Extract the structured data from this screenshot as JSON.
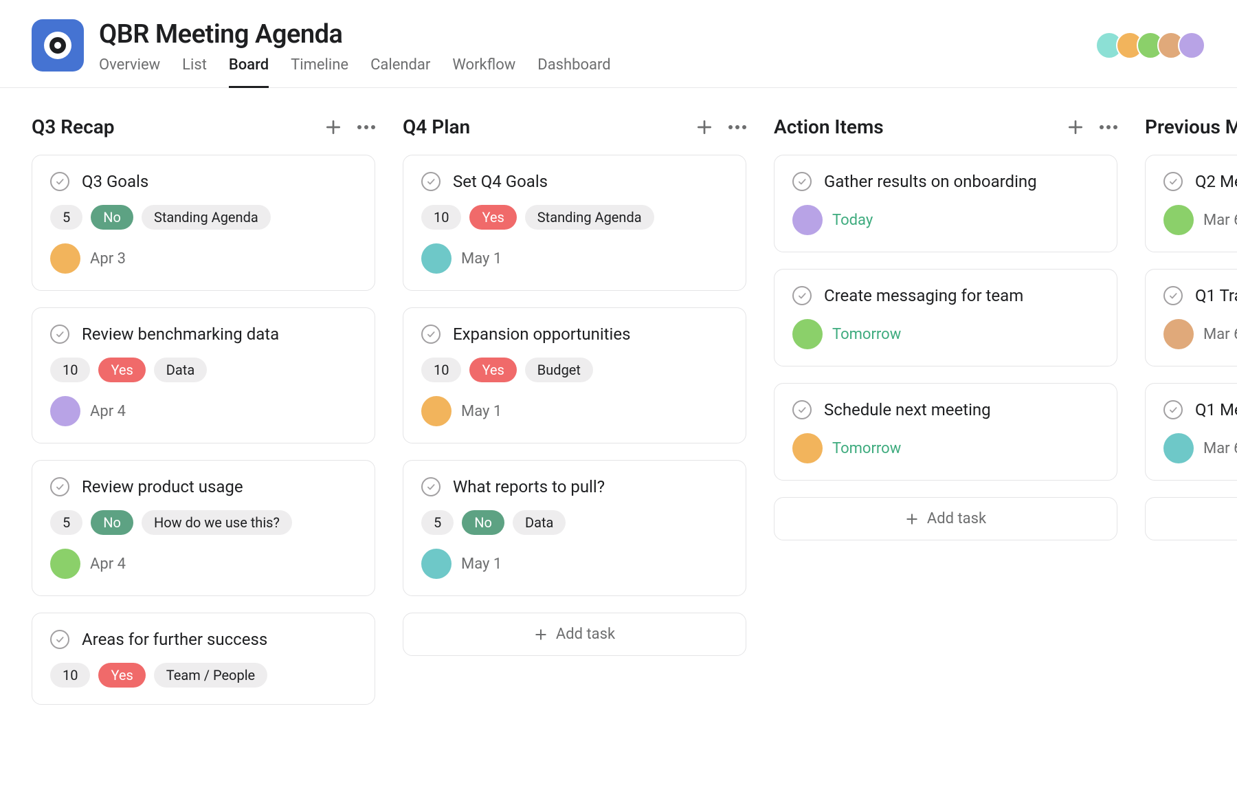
{
  "header": {
    "title": "QBR Meeting Agenda",
    "tabs": [
      {
        "label": "Overview",
        "active": false
      },
      {
        "label": "List",
        "active": false
      },
      {
        "label": "Board",
        "active": true
      },
      {
        "label": "Timeline",
        "active": false
      },
      {
        "label": "Calendar",
        "active": false
      },
      {
        "label": "Workflow",
        "active": false
      },
      {
        "label": "Dashboard",
        "active": false
      }
    ],
    "members": [
      {
        "color": "#8ce0d5"
      },
      {
        "color": "#f2b45c"
      },
      {
        "color": "#8bd06a"
      },
      {
        "color": "#e0a97a"
      },
      {
        "color": "#b8a3e6"
      }
    ]
  },
  "avatarColors": {
    "orange": "#f2b45c",
    "purple": "#b8a3e6",
    "green": "#8bd06a",
    "teal": "#6ec8c8",
    "tan": "#e0a97a"
  },
  "ui": {
    "add_task_label": "Add task"
  },
  "columns": [
    {
      "title": "Q3 Recap",
      "show_add_task": false,
      "cards": [
        {
          "title": "Q3 Goals",
          "pills": [
            {
              "text": "5",
              "variant": ""
            },
            {
              "text": "No",
              "variant": "green"
            },
            {
              "text": "Standing Agenda",
              "variant": ""
            }
          ],
          "assignee": "orange",
          "date": "Apr 3",
          "date_highlight": false,
          "show_footer": true
        },
        {
          "title": "Review benchmarking data",
          "pills": [
            {
              "text": "10",
              "variant": ""
            },
            {
              "text": "Yes",
              "variant": "red"
            },
            {
              "text": "Data",
              "variant": ""
            }
          ],
          "assignee": "purple",
          "date": "Apr 4",
          "date_highlight": false,
          "show_footer": true
        },
        {
          "title": "Review product usage",
          "pills": [
            {
              "text": "5",
              "variant": ""
            },
            {
              "text": "No",
              "variant": "green"
            },
            {
              "text": "How do we use this?",
              "variant": ""
            }
          ],
          "assignee": "green",
          "date": "Apr 4",
          "date_highlight": false,
          "show_footer": true
        },
        {
          "title": "Areas for further success",
          "pills": [
            {
              "text": "10",
              "variant": ""
            },
            {
              "text": "Yes",
              "variant": "red"
            },
            {
              "text": "Team / People",
              "variant": ""
            }
          ],
          "assignee": "",
          "date": "",
          "date_highlight": false,
          "show_footer": false
        }
      ]
    },
    {
      "title": "Q4 Plan",
      "show_add_task": true,
      "cards": [
        {
          "title": "Set Q4 Goals",
          "pills": [
            {
              "text": "10",
              "variant": ""
            },
            {
              "text": "Yes",
              "variant": "red"
            },
            {
              "text": "Standing Agenda",
              "variant": ""
            }
          ],
          "assignee": "teal",
          "date": "May 1",
          "date_highlight": false,
          "show_footer": true
        },
        {
          "title": "Expansion opportunities",
          "pills": [
            {
              "text": "10",
              "variant": ""
            },
            {
              "text": "Yes",
              "variant": "red"
            },
            {
              "text": "Budget",
              "variant": ""
            }
          ],
          "assignee": "orange",
          "date": "May 1",
          "date_highlight": false,
          "show_footer": true
        },
        {
          "title": "What reports to pull?",
          "pills": [
            {
              "text": "5",
              "variant": ""
            },
            {
              "text": "No",
              "variant": "green"
            },
            {
              "text": "Data",
              "variant": ""
            }
          ],
          "assignee": "teal",
          "date": "May 1",
          "date_highlight": false,
          "show_footer": true
        }
      ]
    },
    {
      "title": "Action Items",
      "show_add_task": true,
      "cards": [
        {
          "title": "Gather results on onboarding",
          "pills": [],
          "assignee": "purple",
          "date": "Today",
          "date_highlight": true,
          "show_footer": true
        },
        {
          "title": "Create messaging for team",
          "pills": [],
          "assignee": "green",
          "date": "Tomorrow",
          "date_highlight": true,
          "show_footer": true
        },
        {
          "title": "Schedule next meeting",
          "pills": [],
          "assignee": "orange",
          "date": "Tomorrow",
          "date_highlight": true,
          "show_footer": true
        }
      ]
    },
    {
      "title": "Previous M",
      "show_add_task": true,
      "cards": [
        {
          "title": "Q2 Me",
          "pills": [],
          "assignee": "green",
          "date": "Mar 6",
          "date_highlight": false,
          "show_footer": true
        },
        {
          "title": "Q1 Tra",
          "pills": [],
          "assignee": "tan",
          "date": "Mar 6",
          "date_highlight": false,
          "show_footer": true
        },
        {
          "title": "Q1 Me",
          "pills": [],
          "assignee": "teal",
          "date": "Mar 6",
          "date_highlight": false,
          "show_footer": true
        }
      ]
    }
  ]
}
